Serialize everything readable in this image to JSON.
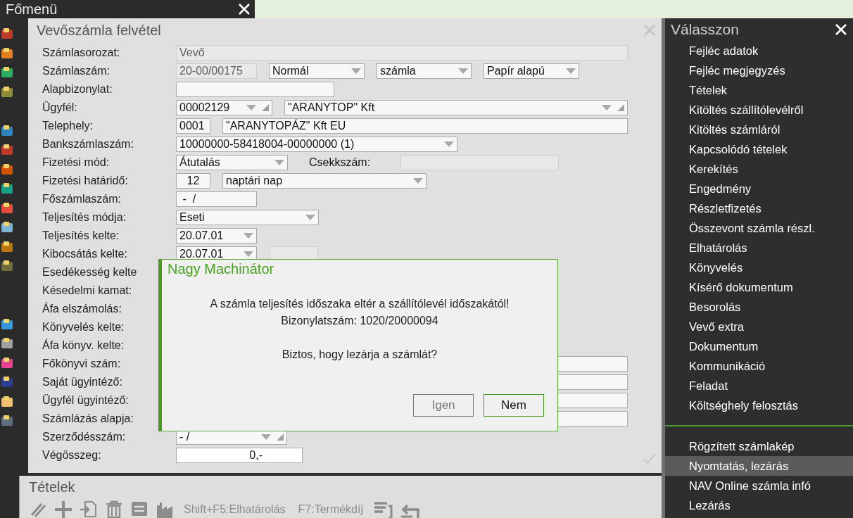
{
  "main_menu": {
    "title": "Főmenü"
  },
  "form": {
    "title": "Vevőszámla felvétel",
    "rows": [
      {
        "label": "Számlasorozat:",
        "fields": [
          {
            "kind": "readonly",
            "value": "Vevő"
          }
        ]
      },
      {
        "label": "Számlaszám:",
        "fields": [
          {
            "kind": "readonly",
            "value": "20-00/00175"
          },
          {
            "kind": "select",
            "value": "Normál"
          },
          {
            "kind": "select",
            "value": "számla"
          },
          {
            "kind": "select",
            "value": "Papír alapú"
          }
        ]
      },
      {
        "label": "Alapbizonylat:",
        "fields": [
          {
            "kind": "text"
          }
        ]
      },
      {
        "label": "Ügyfél:",
        "fields": [
          {
            "kind": "combo",
            "value": "00002129"
          },
          {
            "kind": "combo",
            "value": "\"ARANYTOP\" Kft"
          }
        ]
      },
      {
        "label": "Telephely:",
        "fields": [
          {
            "kind": "text",
            "value": "0001"
          },
          {
            "kind": "text",
            "value": "\"ARANYTOPÁZ\" Kft EU"
          }
        ]
      },
      {
        "label": "Bankszámlaszám:",
        "fields": [
          {
            "kind": "select",
            "value": "10000000-58418004-00000000 (1)"
          }
        ]
      },
      {
        "label": "Fizetési mód:",
        "fields": [
          {
            "kind": "select",
            "value": "Átutalás"
          },
          {
            "kind": "label",
            "value": "Csekkszám:"
          },
          {
            "kind": "readonly"
          }
        ]
      },
      {
        "label": "Fizetési határidő:",
        "fields": [
          {
            "kind": "number",
            "value": "12"
          },
          {
            "kind": "select",
            "value": "naptári nap"
          }
        ]
      },
      {
        "label": "Főszámlaszám:",
        "fields": [
          {
            "kind": "text",
            "value": " -  /"
          }
        ]
      },
      {
        "label": "Teljesítés módja:",
        "fields": [
          {
            "kind": "select",
            "value": "Eseti"
          }
        ]
      },
      {
        "label": "Teljesítés kelte:",
        "fields": [
          {
            "kind": "select",
            "value": "20.07.01"
          }
        ]
      },
      {
        "label": "Kibocsátás kelte:",
        "fields": [
          {
            "kind": "select",
            "value": "20.07.01"
          },
          {
            "kind": "readonly"
          }
        ]
      },
      {
        "label": "Esedékesség kelte",
        "fields": []
      },
      {
        "label": "Késedelmi kamat:",
        "fields": []
      },
      {
        "label": "Áfa elszámolás:",
        "fields": []
      },
      {
        "label": "Könyvelés kelte:",
        "fields": []
      },
      {
        "label": "Áfa könyv. kelte:",
        "fields": []
      },
      {
        "label": "Főkönyvi szám:",
        "fields": [
          {
            "kind": "combo"
          }
        ]
      },
      {
        "label": "Saját ügyintéző:",
        "fields": [
          {
            "kind": "combo"
          }
        ]
      },
      {
        "label": "Ügyfél ügyintéző:",
        "fields": [
          {
            "kind": "combo"
          }
        ]
      },
      {
        "label": "Számlázás alapja:",
        "fields": [
          {
            "kind": "text"
          }
        ]
      },
      {
        "label": "Szerződésszám:",
        "fields": [
          {
            "kind": "combo",
            "value": "- /"
          }
        ]
      },
      {
        "label": "Végösszeg:",
        "fields": [
          {
            "kind": "amount",
            "value": "0,-"
          }
        ]
      }
    ]
  },
  "items_panel": {
    "title": "Tételek",
    "toolbar_disabled": true,
    "shortcuts": [
      "Shift+F5:Elhatárolás",
      "F7:Termékdíj"
    ]
  },
  "dialog": {
    "title": "Nagy Machinátor",
    "paragraphs": [
      [
        "A számla teljesítés időszaka eltér a szállítólevél időszakától!",
        "Bizonylatszám: 1020/20000094"
      ],
      [
        "Biztos, hogy lezárja a számlát?"
      ]
    ],
    "buttons": [
      {
        "label": "Igen",
        "focused": false
      },
      {
        "label": "Nem",
        "focused": true
      }
    ]
  },
  "choose_menu": {
    "title": "Válasszon",
    "groups": [
      [
        {
          "label": "Fejléc adatok",
          "selected": false
        },
        {
          "label": "Fejléc megjegyzés",
          "selected": false
        },
        {
          "label": "Tételek",
          "selected": false
        },
        {
          "label": "Kitöltés szállítólevélről",
          "selected": false
        },
        {
          "label": "Kitöltés számláról",
          "selected": false
        },
        {
          "label": "Kapcsolódó tételek",
          "selected": false
        },
        {
          "label": "Kerekítés",
          "selected": false
        },
        {
          "label": "Engedmény",
          "selected": false
        },
        {
          "label": "Részletfizetés",
          "selected": false
        },
        {
          "label": "Összevont számla részl.",
          "selected": false
        },
        {
          "label": "Elhatárolás",
          "selected": false
        },
        {
          "label": "Könyvelés",
          "selected": false
        },
        {
          "label": "Kísérő dokumentum",
          "selected": false
        },
        {
          "label": "Besorolás",
          "selected": false
        },
        {
          "label": "Vevő extra",
          "selected": false
        },
        {
          "label": "Dokumentum",
          "selected": false
        },
        {
          "label": "Kommunikáció",
          "selected": false
        },
        {
          "label": "Feladat",
          "selected": false
        },
        {
          "label": "Költséghely felosztás",
          "selected": false
        }
      ],
      [
        {
          "label": "Rögzített számlakép",
          "selected": false
        },
        {
          "label": "Nyomtatás, lezárás",
          "selected": true
        },
        {
          "label": "NAV Online számla infó",
          "selected": false
        },
        {
          "label": "Lezárás",
          "selected": false
        }
      ]
    ]
  }
}
